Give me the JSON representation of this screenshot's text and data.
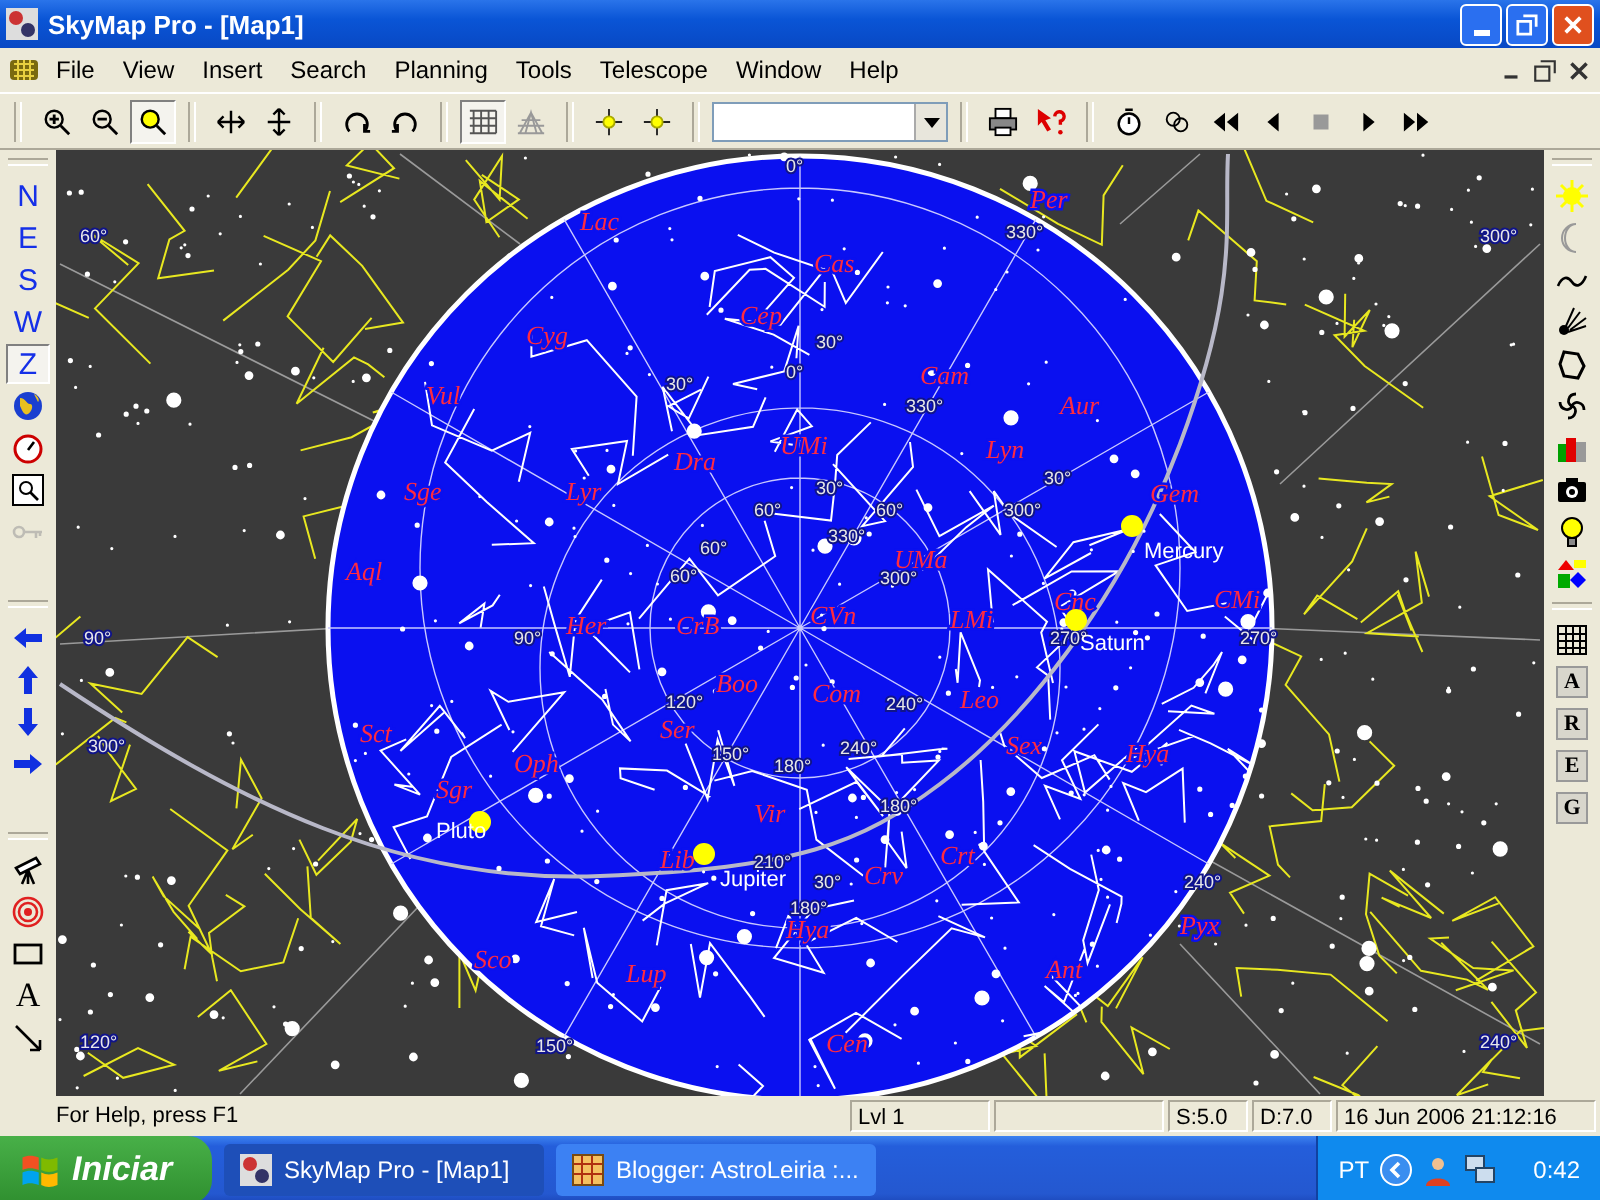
{
  "window": {
    "title": "SkyMap Pro - [Map1]"
  },
  "menu": [
    "File",
    "View",
    "Insert",
    "Search",
    "Planning",
    "Tools",
    "Telescope",
    "Window",
    "Help"
  ],
  "toolbar": [
    {
      "kind": "buttons",
      "buttons": [
        {
          "selected": false
        },
        {
          "selected": false
        },
        {
          "selected": true
        }
      ]
    },
    {
      "kind": "buttons",
      "buttons": [
        {
          "selected": false
        },
        {
          "selected": false
        }
      ]
    },
    {
      "kind": "buttons",
      "buttons": [
        {
          "selected": false
        },
        {
          "selected": false
        }
      ]
    },
    {
      "kind": "buttons",
      "buttons": [
        {
          "selected": true
        },
        {
          "selected": false
        }
      ]
    },
    {
      "kind": "buttons",
      "buttons": [
        {
          "selected": false
        },
        {
          "selected": false
        }
      ]
    },
    {
      "kind": "combo"
    },
    {
      "kind": "buttons",
      "buttons": [
        {
          "selected": false
        },
        {
          "selected": false
        }
      ]
    },
    {
      "kind": "buttons",
      "buttons": [
        {
          "selected": false
        },
        {
          "selected": false
        },
        {
          "selected": false
        },
        {
          "selected": false
        },
        {
          "selected": false
        },
        {
          "selected": false
        },
        {
          "selected": false
        }
      ]
    }
  ],
  "left_toolbar": [
    {
      "items": [
        {
          "kind": "letter",
          "label": "N",
          "selected": false,
          "disabled": false
        },
        {
          "kind": "letter",
          "label": "E",
          "selected": false,
          "disabled": false
        },
        {
          "kind": "letter",
          "label": "S",
          "selected": false,
          "disabled": false
        },
        {
          "kind": "letter",
          "label": "W",
          "selected": false,
          "disabled": false
        },
        {
          "kind": "letter",
          "label": "Z",
          "selected": true,
          "disabled": false
        },
        {
          "kind": "icon",
          "selected": false,
          "disabled": false
        },
        {
          "kind": "icon",
          "selected": false,
          "disabled": false
        },
        {
          "kind": "icon",
          "selected": false,
          "disabled": false
        },
        {
          "kind": "icon",
          "selected": false,
          "disabled": true
        }
      ]
    },
    {
      "items": [
        {
          "kind": "icon",
          "selected": false,
          "disabled": false
        },
        {
          "kind": "icon",
          "selected": false,
          "disabled": false
        },
        {
          "kind": "icon",
          "selected": false,
          "disabled": false
        },
        {
          "kind": "icon",
          "selected": false,
          "disabled": false
        }
      ]
    },
    {
      "items": [
        {
          "kind": "icon",
          "selected": false,
          "disabled": false
        },
        {
          "kind": "icon",
          "selected": false,
          "disabled": false
        },
        {
          "kind": "icon",
          "selected": false,
          "disabled": false
        },
        {
          "kind": "serif-letter",
          "label": "A",
          "selected": false,
          "disabled": false
        },
        {
          "kind": "icon",
          "selected": false,
          "disabled": false
        }
      ]
    }
  ],
  "right_toolbar": [
    {
      "items": [
        {
          "kind": "icon"
        },
        {
          "kind": "icon"
        },
        {
          "kind": "icon"
        },
        {
          "kind": "icon"
        },
        {
          "kind": "icon"
        },
        {
          "kind": "icon"
        },
        {
          "kind": "icon"
        },
        {
          "kind": "icon"
        },
        {
          "kind": "icon"
        },
        {
          "kind": "icon"
        }
      ]
    },
    {
      "items": [
        {
          "kind": "icon"
        },
        {
          "kind": "boxed-letter",
          "label": "A"
        },
        {
          "kind": "boxed-letter",
          "label": "R"
        },
        {
          "kind": "boxed-letter",
          "label": "E"
        },
        {
          "kind": "boxed-letter",
          "label": "G"
        }
      ]
    }
  ],
  "map": {
    "constellations": [
      "Lac",
      "Per",
      "Cas",
      "Cyg",
      "Cep",
      "Vul",
      "Cam",
      "Aur",
      "Dra",
      "UMi",
      "Lyn",
      "Sge",
      "Lyr",
      "Gem",
      "Aql",
      "UMa",
      "Her",
      "CrB",
      "CVn",
      "LMi",
      "Cnc",
      "CMi",
      "Boo",
      "Com",
      "Leo",
      "Sct",
      "Oph",
      "Ser",
      "Sex",
      "Hya",
      "Sgr",
      "Vir",
      "Lib",
      "Crv",
      "Crt",
      "Hya",
      "Pyx",
      "Sco",
      "Lup",
      "Ant",
      "Cen"
    ],
    "planets": [
      "Mercury",
      "Saturn",
      "Jupiter",
      "Pluto"
    ],
    "degree_labels": [
      "0°",
      "60°",
      "330°",
      "300°",
      "30°",
      "30°",
      "0°",
      "330°",
      "30°",
      "30°",
      "60°",
      "60°",
      "300°",
      "60°",
      "330°",
      "60°",
      "300°",
      "90°",
      "90°",
      "270°",
      "270°",
      "120°",
      "240°",
      "300°",
      "150°",
      "180°",
      "240°",
      "180°",
      "210°",
      "30°",
      "240°",
      "180°",
      "120°",
      "150°",
      "240°"
    ]
  },
  "status_bar": {
    "help": "For Help, press F1",
    "level": "Lvl 1",
    "magnitude": "S:5.0",
    "depth": "D:7.0",
    "datetime": "16 Jun 2006 21:12:16"
  },
  "taskbar": {
    "start": "Iniciar",
    "tasks": [
      {
        "label": "SkyMap Pro - [Map1]",
        "selected": true
      },
      {
        "label": "Blogger: AstroLeiria :...",
        "selected": false
      }
    ],
    "language": "PT",
    "clock": "0:42"
  }
}
